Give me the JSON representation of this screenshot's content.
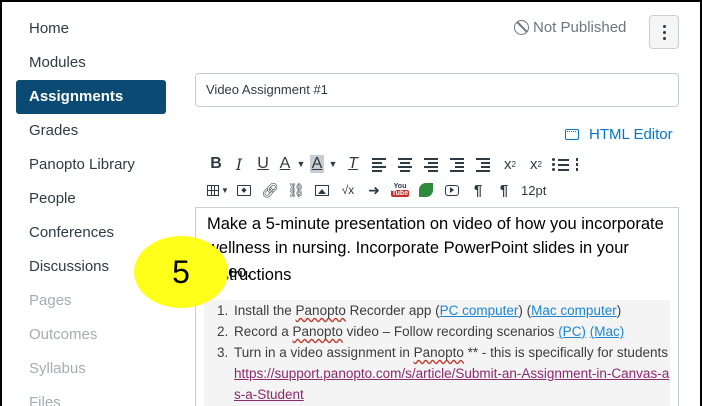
{
  "sidebar": {
    "items": [
      {
        "label": "Home"
      },
      {
        "label": "Modules"
      },
      {
        "label": "Assignments"
      },
      {
        "label": "Grades"
      },
      {
        "label": "Panopto Library"
      },
      {
        "label": "People"
      },
      {
        "label": "Conferences"
      },
      {
        "label": "Discussions"
      },
      {
        "label": "Pages"
      },
      {
        "label": "Outcomes"
      },
      {
        "label": "Syllabus"
      },
      {
        "label": "Files"
      }
    ],
    "active": "Assignments"
  },
  "header": {
    "status": "Not Published"
  },
  "title_input": {
    "value": "Video Assignment #1"
  },
  "editor": {
    "html_editor_label": "HTML Editor",
    "font_size": "12pt",
    "toolbar": {
      "bold": "B",
      "italic": "I",
      "underline": "U",
      "text_color": "A",
      "bg_color": "A",
      "clear_format": "T",
      "superscript": "x",
      "subscript": "x",
      "youtube_top": "You",
      "youtube_bottom": "Tube",
      "pilcrow_ltr": "¶",
      "pilcrow_rtl": "¶",
      "math": "√x"
    },
    "body": {
      "paragraph": "Make a 5-minute presentation on video of how you incorporate wellness in nursing. Incorporate PowerPoint slides in your video.",
      "heading": "Instructions",
      "steps": [
        {
          "pre": "Install the ",
          "sq": "Panopto",
          "mid": " Recorder app (",
          "link1": "PC computer",
          "mid2": ") (",
          "link2": "Mac computer",
          "post": ")"
        },
        {
          "pre": "Record a ",
          "sq": "Panopto",
          "mid": " video – Follow recording scenarios ",
          "link1": "(PC)",
          "mid2": " ",
          "link2": "(Mac)",
          "post": ""
        },
        {
          "pre": "Turn in a video assignment in ",
          "sq": "Panopto",
          "mid": " ** - this is specifically for students ",
          "link1": "https://support.panopto.com/s/article/Submit-an-Assignment-in-Canvas-as-a-Student",
          "mid2": "",
          "link2": "",
          "post": ""
        }
      ]
    }
  },
  "annotation": {
    "number": "5"
  },
  "colors": {
    "active_nav": "#0b4a73",
    "link": "#0077c8",
    "callout": "#ffff1a"
  }
}
